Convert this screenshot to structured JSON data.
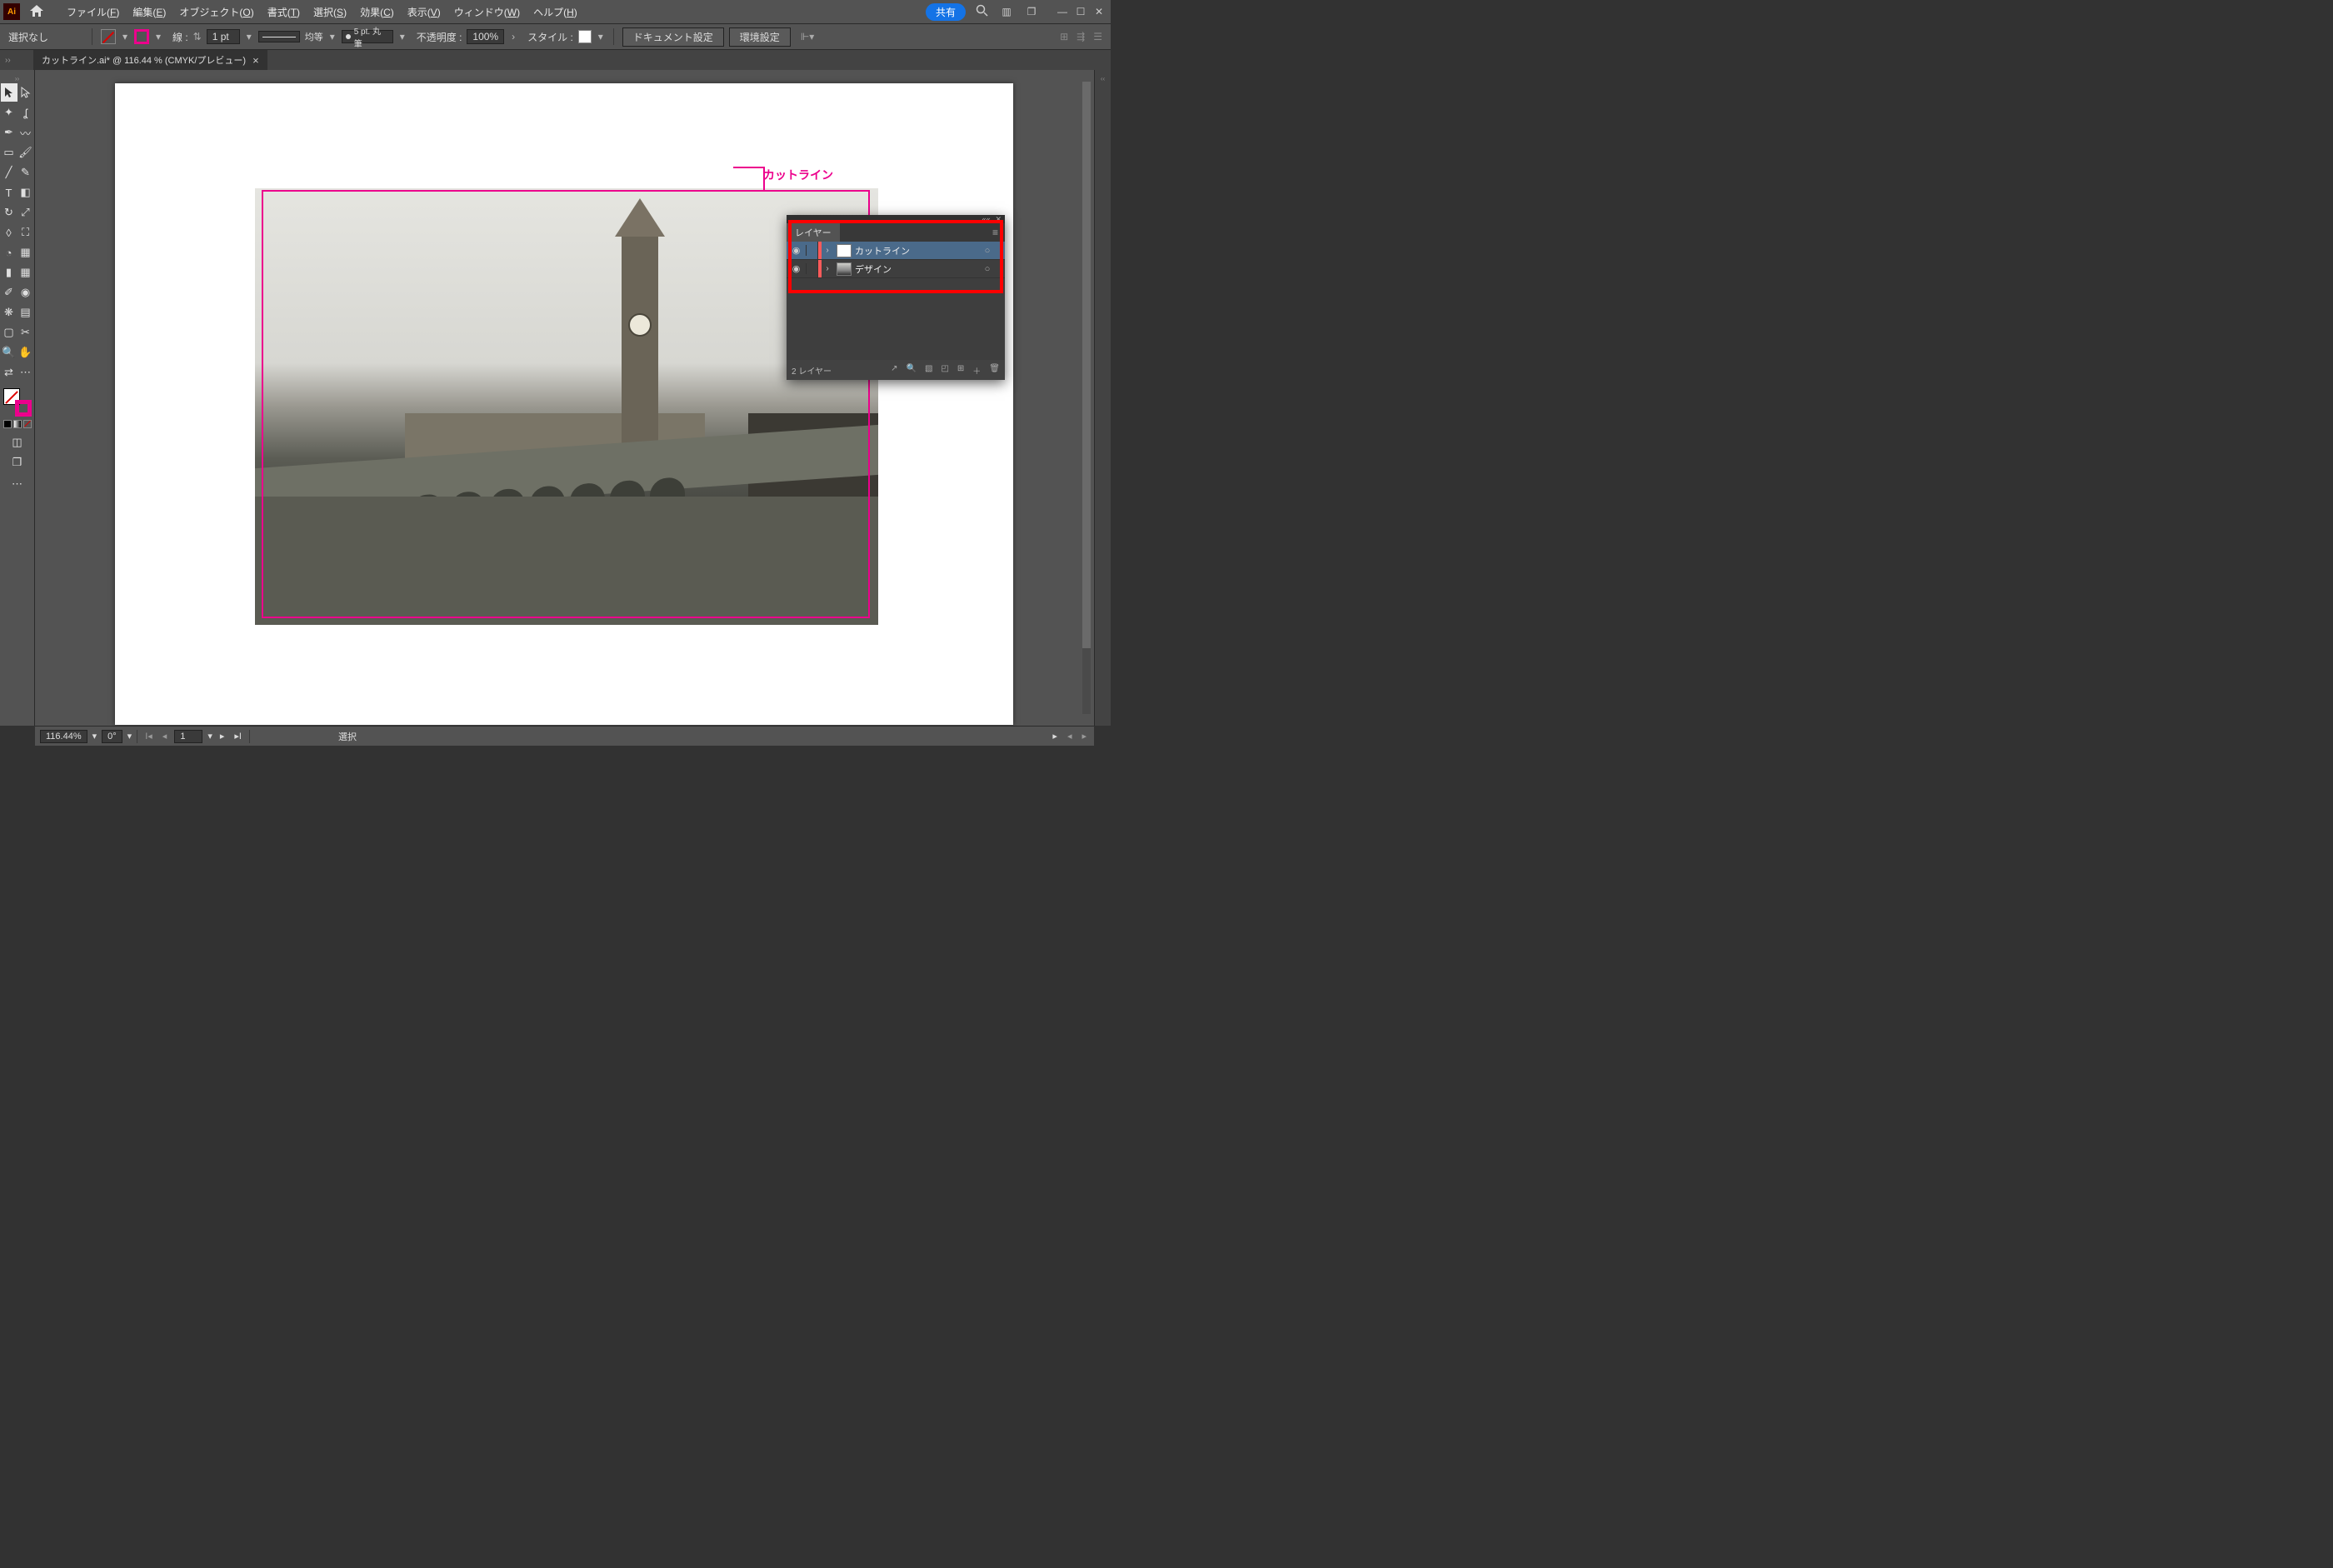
{
  "menubar": {
    "items": [
      {
        "pre": "ファイル(",
        "u": "F",
        "post": ")"
      },
      {
        "pre": "編集(",
        "u": "E",
        "post": ")"
      },
      {
        "pre": "オブジェクト(",
        "u": "O",
        "post": ")"
      },
      {
        "pre": "書式(",
        "u": "T",
        "post": ")"
      },
      {
        "pre": "選択(",
        "u": "S",
        "post": ")"
      },
      {
        "pre": "効果(",
        "u": "C",
        "post": ")"
      },
      {
        "pre": "表示(",
        "u": "V",
        "post": ")"
      },
      {
        "pre": "ウィンドウ(",
        "u": "W",
        "post": ")"
      },
      {
        "pre": "ヘルプ(",
        "u": "H",
        "post": ")"
      }
    ],
    "share": "共有"
  },
  "controlbar": {
    "selection": "選択なし",
    "stroke_label": "線 :",
    "stroke_weight": "1 pt",
    "uniform": "均等",
    "brush": "5 pt. 丸筆",
    "opacity_label": "不透明度 :",
    "opacity_value": "100%",
    "style_label": "スタイル :",
    "doc_setup": "ドキュメント設定",
    "prefs": "環境設定"
  },
  "tab": {
    "title": "カットライン.ai* @ 116.44 % (CMYK/プレビュー)"
  },
  "canvas": {
    "cutline_label": "カットライン"
  },
  "layers_panel": {
    "title": "レイヤー",
    "rows": [
      {
        "name": "カットライン",
        "selected": true,
        "thumb": "plain"
      },
      {
        "name": "デザイン",
        "selected": false,
        "thumb": "img"
      }
    ],
    "footer_count": "2 レイヤー"
  },
  "statusbar": {
    "zoom": "116.44%",
    "rotate": "0°",
    "artboard": "1",
    "tool": "選択"
  }
}
